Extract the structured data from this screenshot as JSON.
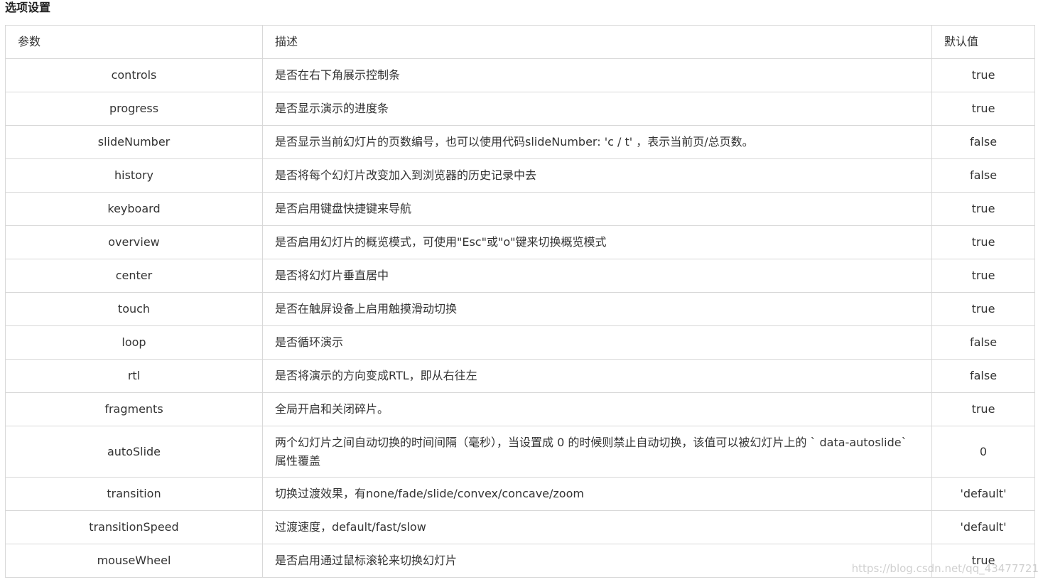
{
  "section_title": "选项设置",
  "table": {
    "headers": {
      "param": "参数",
      "description": "描述",
      "default": "默认值"
    },
    "rows": [
      {
        "param": "controls",
        "description": "是否在右下角展示控制条",
        "default": "true"
      },
      {
        "param": "progress",
        "description": "是否显示演示的进度条",
        "default": "true"
      },
      {
        "param": "slideNumber",
        "description": "是否显示当前幻灯片的页数编号，也可以使用代码slideNumber: 'c / t' ，表示当前页/总页数。",
        "default": "false"
      },
      {
        "param": "history",
        "description": "是否将每个幻灯片改变加入到浏览器的历史记录中去",
        "default": "false"
      },
      {
        "param": "keyboard",
        "description": "是否启用键盘快捷键来导航",
        "default": "true"
      },
      {
        "param": "overview",
        "description": "是否启用幻灯片的概览模式，可使用\"Esc\"或\"o\"键来切换概览模式",
        "default": "true"
      },
      {
        "param": "center",
        "description": "是否将幻灯片垂直居中",
        "default": "true"
      },
      {
        "param": "touch",
        "description": "是否在触屏设备上启用触摸滑动切换",
        "default": "true"
      },
      {
        "param": "loop",
        "description": "是否循环演示",
        "default": "false"
      },
      {
        "param": "rtl",
        "description": "是否将演示的方向变成RTL，即从右往左",
        "default": "false"
      },
      {
        "param": "fragments",
        "description": "全局开启和关闭碎片。",
        "default": "true"
      },
      {
        "param": "autoSlide",
        "description": "两个幻灯片之间自动切换的时间间隔（毫秒），当设置成 0 的时候则禁止自动切换，该值可以被幻灯片上的 ` data-autoslide` 属性覆盖",
        "default": "0"
      },
      {
        "param": "transition",
        "description": "切换过渡效果，有none/fade/slide/convex/concave/zoom",
        "default": "'default'"
      },
      {
        "param": "transitionSpeed",
        "description": "过渡速度，default/fast/slow",
        "default": "'default'"
      },
      {
        "param": "mouseWheel",
        "description": "是否启用通过鼠标滚轮来切换幻灯片",
        "default": "true"
      }
    ]
  },
  "watermark": "https://blog.csdn.net/qq_43477721"
}
